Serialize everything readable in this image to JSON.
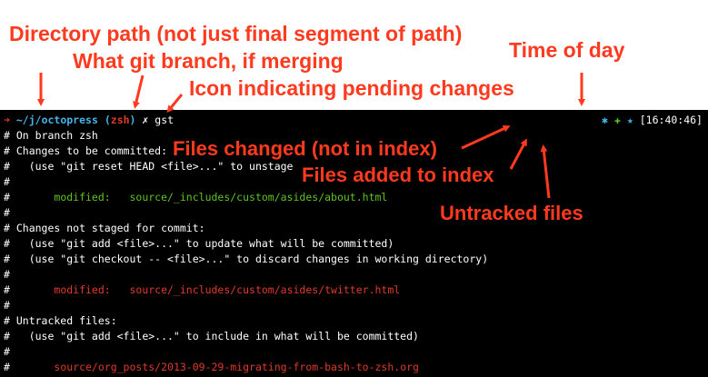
{
  "annotations": {
    "directory_path": "Directory path (not just final segment of path)",
    "git_branch": "What git branch, if merging",
    "pending_icon": "Icon indicating pending changes",
    "time_of_day": "Time of day",
    "files_changed": "Files changed (not in index)",
    "files_added": "Files added to index",
    "untracked": "Untracked files"
  },
  "prompt": {
    "arrow": "➜",
    "path": "~/j/octopress",
    "branch_open": "(",
    "branch": "zsh",
    "branch_close": ")",
    "dirty_icon": "✗",
    "command": "gst",
    "status_changed": "✱",
    "status_added": "✚",
    "status_untracked": "★",
    "time": "[16:40:46]"
  },
  "output": {
    "l1": "# On branch zsh",
    "l2": "# Changes to be committed:",
    "l3": "#   (use \"git reset HEAD <file>...\" to unstage",
    "l4": "#",
    "l5_prefix": "#       ",
    "l5_label": "modified:   ",
    "l5_file": "source/_includes/custom/asides/about.html",
    "l6": "#",
    "l7": "# Changes not staged for commit:",
    "l8": "#   (use \"git add <file>...\" to update what will be committed)",
    "l9": "#   (use \"git checkout -- <file>...\" to discard changes in working directory)",
    "l10": "#",
    "l11_prefix": "#       ",
    "l11_label": "modified:   ",
    "l11_file": "source/_includes/custom/asides/twitter.html",
    "l12": "#",
    "l13": "# Untracked files:",
    "l14": "#   (use \"git add <file>...\" to include in what will be committed)",
    "l15": "#",
    "l16_prefix": "#       ",
    "l16_file": "source/org_posts/2013-09-29-migrating-from-bash-to-zsh.org"
  },
  "colors": {
    "annotation": "#ff3a1e",
    "terminal_bg": "#000000",
    "red": "#e0392b",
    "green": "#5ec41f",
    "cyan": "#46b3e6"
  }
}
